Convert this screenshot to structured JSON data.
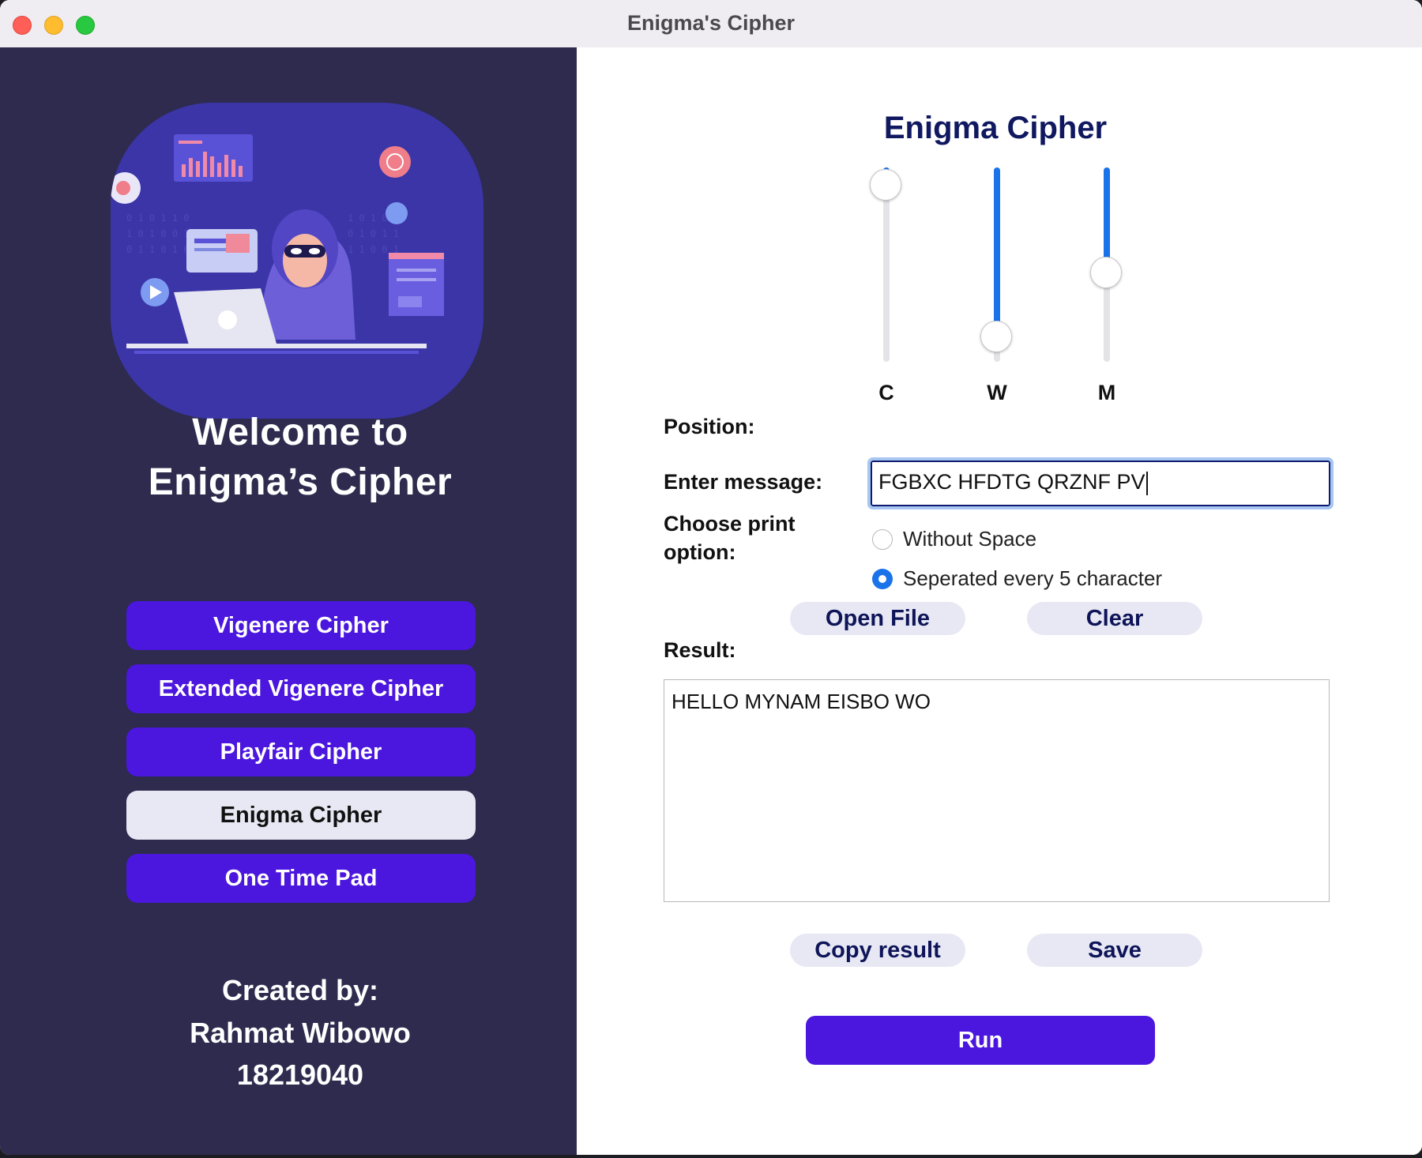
{
  "window": {
    "title": "Enigma's Cipher"
  },
  "sidebar": {
    "welcome_line1": "Welcome to",
    "welcome_line2": "Enigma’s Cipher",
    "nav": [
      {
        "label": "Vigenere Cipher",
        "active": false
      },
      {
        "label": "Extended Vigenere Cipher",
        "active": false
      },
      {
        "label": "Playfair Cipher",
        "active": false
      },
      {
        "label": "Enigma Cipher",
        "active": true
      },
      {
        "label": "One Time Pad",
        "active": false
      }
    ],
    "credits_line1": "Created by:",
    "credits_line2": "Rahmat Wibowo",
    "credits_line3": "18219040"
  },
  "main": {
    "title": "Enigma Cipher",
    "rotors": [
      {
        "label": "C",
        "level": 0.05
      },
      {
        "label": "W",
        "level": 0.83
      },
      {
        "label": "M",
        "level": 0.5
      }
    ],
    "position_label": "Position:",
    "message_label": "Enter message:",
    "message_value": "FGBXC HFDTG QRZNF PV",
    "print_option_label_1": "Choose print",
    "print_option_label_2": "option:",
    "options": [
      {
        "label": "Without Space",
        "selected": false
      },
      {
        "label": "Seperated every 5 character",
        "selected": true
      }
    ],
    "open_file_label": "Open File",
    "clear_label": "Clear",
    "result_label": "Result:",
    "result_value": "HELLO MYNAM EISBO WO",
    "copy_label": "Copy result",
    "save_label": "Save",
    "run_label": "Run"
  },
  "colors": {
    "sidebar_bg": "#2e2b4e",
    "accent_purple": "#4b16de",
    "slider_blue": "#1a73e8",
    "title_navy": "#101860"
  }
}
